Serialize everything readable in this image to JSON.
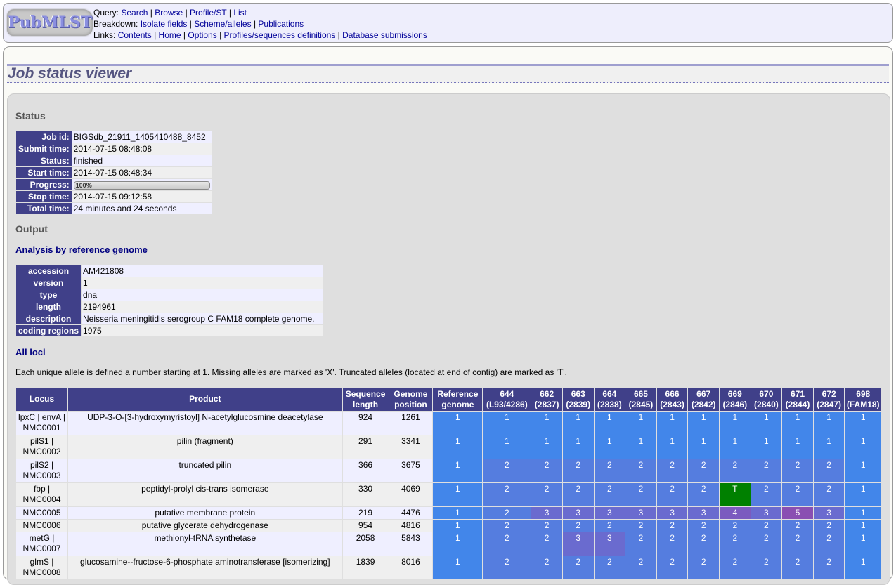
{
  "menu": {
    "logo_text": "PubMLST",
    "query_label": "Query:",
    "query_links": [
      "Search",
      "Browse",
      "Profile/ST",
      "List"
    ],
    "breakdown_label": "Breakdown:",
    "breakdown_links": [
      "Isolate fields",
      "Scheme/alleles",
      "Publications"
    ],
    "links_label": "Links:",
    "links_links": [
      "Contents",
      "Home",
      "Options",
      "Profiles/sequences definitions",
      "Database submissions"
    ]
  },
  "page_title": "Job status viewer",
  "status": {
    "heading": "Status",
    "rows": [
      {
        "label": "Job id:",
        "value": "BIGSdb_21911_1405410488_8452"
      },
      {
        "label": "Submit time:",
        "value": "2014-07-15 08:48:08"
      },
      {
        "label": "Status:",
        "value": "finished"
      },
      {
        "label": "Start time:",
        "value": "2014-07-15 08:48:34"
      },
      {
        "label": "Progress:",
        "value": "100%",
        "progress_percent": 100
      },
      {
        "label": "Stop time:",
        "value": "2014-07-15 09:12:58"
      },
      {
        "label": "Total time:",
        "value": "24 minutes and 24 seconds"
      }
    ]
  },
  "output": {
    "heading": "Output",
    "reference_heading": "Analysis by reference genome",
    "reference_rows": [
      {
        "label": "accession",
        "value": "AM421808"
      },
      {
        "label": "version",
        "value": "1"
      },
      {
        "label": "type",
        "value": "dna"
      },
      {
        "label": "length",
        "value": "2194961"
      },
      {
        "label": "description",
        "value": "Neisseria meningitidis serogroup C FAM18 complete genome."
      },
      {
        "label": "coding regions",
        "value": "1975"
      }
    ],
    "loci_heading": "All loci",
    "loci_note": "Each unique allele is defined a number starting at 1. Missing alleles are marked as 'X'. Truncated alleles (located at end of contig) are marked as 'T'.",
    "table": {
      "headers": [
        {
          "line1": "Locus",
          "line2": ""
        },
        {
          "line1": "Product",
          "line2": ""
        },
        {
          "line1": "Sequence",
          "line2": "length"
        },
        {
          "line1": "Genome",
          "line2": "position"
        },
        {
          "line1": "Reference",
          "line2": "genome"
        },
        {
          "line1": "644",
          "line2": "(L93/4286)"
        },
        {
          "line1": "662",
          "line2": "(2837)"
        },
        {
          "line1": "663",
          "line2": "(2839)"
        },
        {
          "line1": "664",
          "line2": "(2838)"
        },
        {
          "line1": "665",
          "line2": "(2845)"
        },
        {
          "line1": "666",
          "line2": "(2843)"
        },
        {
          "line1": "667",
          "line2": "(2842)"
        },
        {
          "line1": "669",
          "line2": "(2846)"
        },
        {
          "line1": "670",
          "line2": "(2840)"
        },
        {
          "line1": "671",
          "line2": "(2844)"
        },
        {
          "line1": "672",
          "line2": "(2847)"
        },
        {
          "line1": "698",
          "line2": "(FAM18)"
        }
      ],
      "rows": [
        {
          "locus1": "lpxC | envA |",
          "locus2": "NMC0001",
          "product": "UDP-3-O-[3-hydroxymyristoyl] N-acetylglucosmine deacetylase",
          "length": "924",
          "position": "1261",
          "alleles": [
            "1",
            "1",
            "1",
            "1",
            "1",
            "1",
            "1",
            "1",
            "1",
            "1",
            "1",
            "1",
            "1"
          ]
        },
        {
          "locus1": "pilS1 |",
          "locus2": "NMC0002",
          "product": "pilin (fragment)",
          "length": "291",
          "position": "3341",
          "alleles": [
            "1",
            "1",
            "1",
            "1",
            "1",
            "1",
            "1",
            "1",
            "1",
            "1",
            "1",
            "1",
            "1"
          ]
        },
        {
          "locus1": "pilS2 |",
          "locus2": "NMC0003",
          "product": "truncated pilin",
          "length": "366",
          "position": "3675",
          "alleles": [
            "1",
            "2",
            "2",
            "2",
            "2",
            "2",
            "2",
            "2",
            "2",
            "2",
            "2",
            "2",
            "1"
          ]
        },
        {
          "locus1": "fbp |",
          "locus2": "NMC0004",
          "product": "peptidyl-prolyl cis-trans isomerase",
          "length": "330",
          "position": "4069",
          "alleles": [
            "1",
            "2",
            "2",
            "2",
            "2",
            "2",
            "2",
            "2",
            "T",
            "2",
            "2",
            "2",
            "1"
          ]
        },
        {
          "locus1": "NMC0005",
          "locus2": "",
          "product": "putative membrane protein",
          "length": "219",
          "position": "4476",
          "alleles": [
            "1",
            "2",
            "3",
            "3",
            "3",
            "3",
            "3",
            "3",
            "4",
            "3",
            "5",
            "3",
            "1"
          ]
        },
        {
          "locus1": "NMC0006",
          "locus2": "",
          "product": "putative glycerate dehydrogenase",
          "length": "954",
          "position": "4816",
          "alleles": [
            "1",
            "2",
            "2",
            "2",
            "2",
            "2",
            "2",
            "2",
            "2",
            "2",
            "2",
            "2",
            "1"
          ]
        },
        {
          "locus1": "metG |",
          "locus2": "NMC0007",
          "product": "methionyl-tRNA synthetase",
          "length": "2058",
          "position": "5843",
          "alleles": [
            "1",
            "2",
            "2",
            "3",
            "3",
            "2",
            "2",
            "2",
            "2",
            "2",
            "2",
            "2",
            "1"
          ]
        },
        {
          "locus1": "glmS |",
          "locus2": "NMC0008",
          "product": "glucosamine--fructose-6-phosphate aminotransferase [isomerizing]",
          "length": "1839",
          "position": "8016",
          "alleles": [
            "1",
            "2",
            "2",
            "2",
            "2",
            "2",
            "2",
            "2",
            "2",
            "2",
            "2",
            "2",
            "1"
          ]
        }
      ]
    }
  },
  "colors": {
    "header_bg": "#404089",
    "allele_1": "#4286ea",
    "allele_2": "#557ddf",
    "allele_3": "#6a6bcf",
    "allele_4": "#7b5bbf",
    "allele_5": "#8a4fb2",
    "allele_truncated": "#008000"
  }
}
